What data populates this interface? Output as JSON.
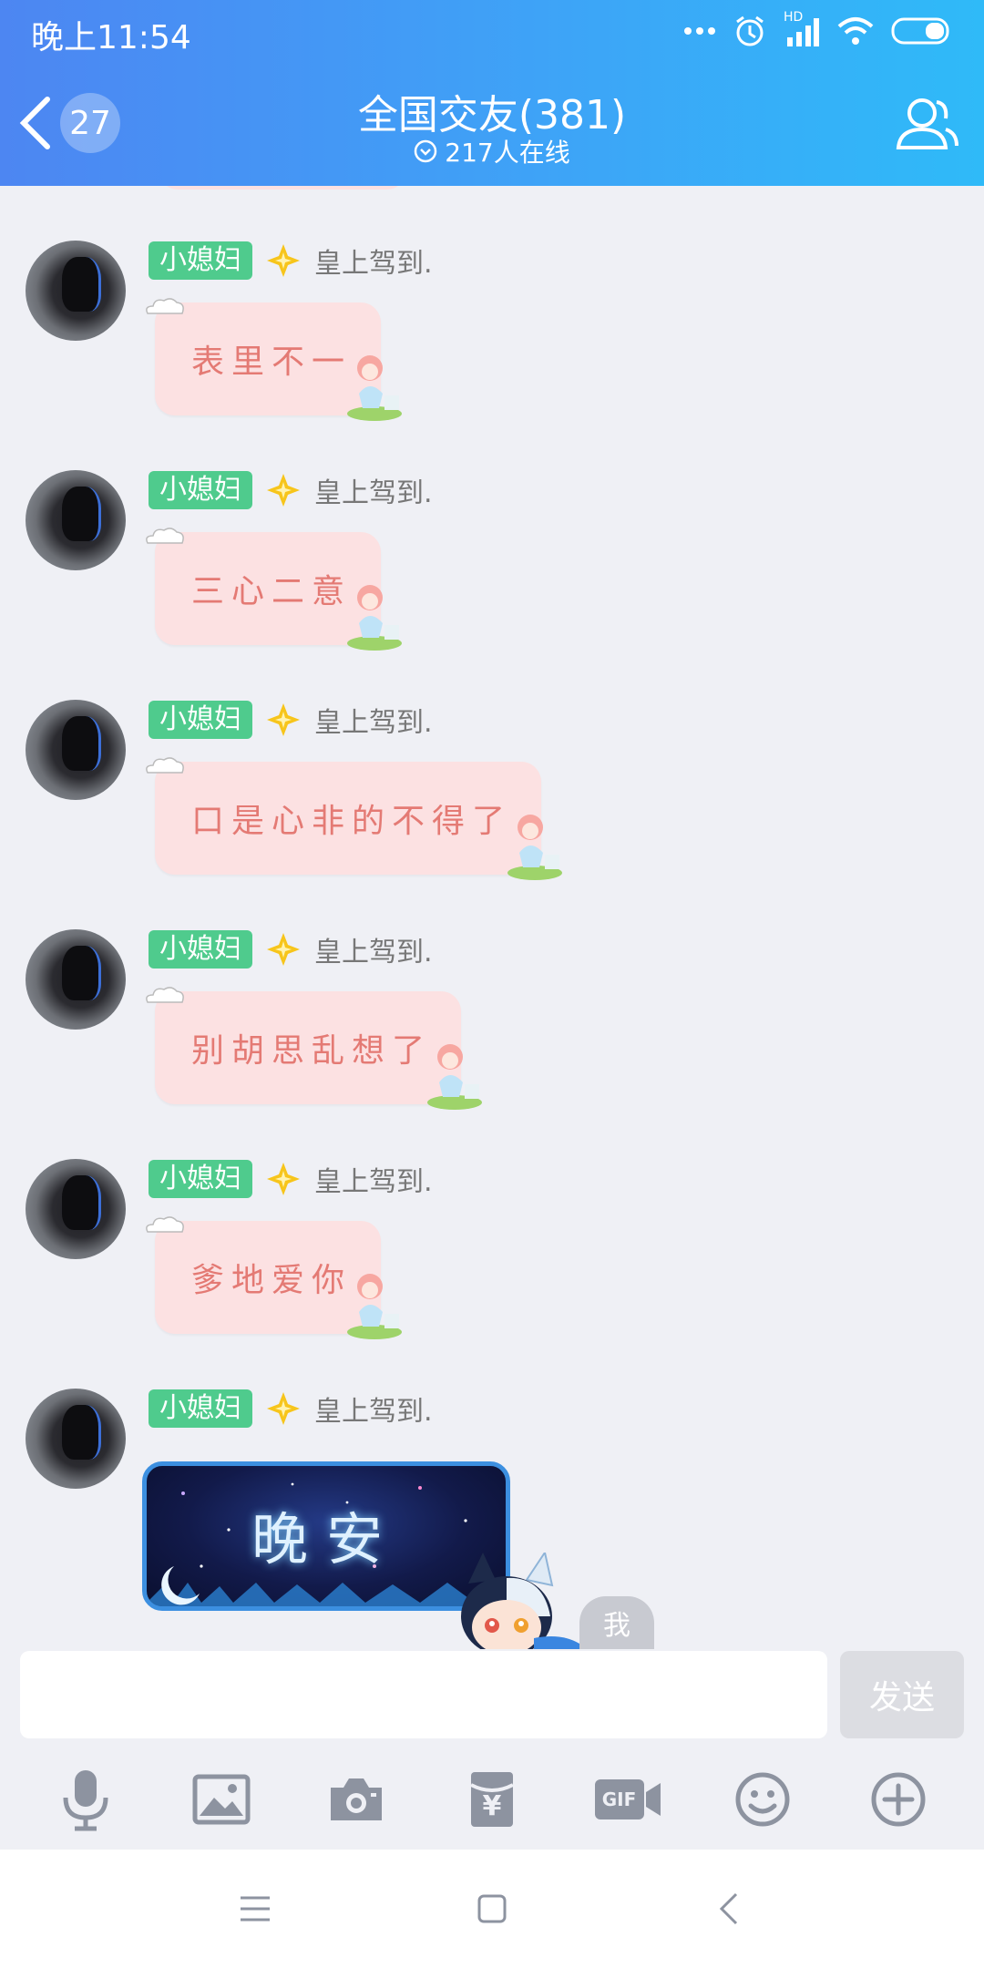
{
  "status_bar": {
    "time": "晚上11:54",
    "network_label": "HD"
  },
  "header": {
    "unread_count": "27",
    "group_name": "全国交友(381)",
    "online_text": "217人在线"
  },
  "messages": [
    {
      "sender": "小媳妇",
      "title": "皇上驾到.",
      "text": "表里不一"
    },
    {
      "sender": "小媳妇",
      "title": "皇上驾到.",
      "text": "三心二意"
    },
    {
      "sender": "小媳妇",
      "title": "皇上驾到.",
      "text": "口是心非的不得了"
    },
    {
      "sender": "小媳妇",
      "title": "皇上驾到.",
      "text": "别胡思乱想了"
    },
    {
      "sender": "小媳妇",
      "title": "皇上驾到.",
      "text": "爹地爱你"
    },
    {
      "sender": "小媳妇",
      "title": "皇上驾到.",
      "image_text": "晚安"
    }
  ],
  "self_label": "我",
  "input": {
    "value": "",
    "send_label": "发送"
  },
  "toolbar": {
    "icons": [
      "microphone-icon",
      "image-icon",
      "camera-icon",
      "red-packet-icon",
      "gif-icon",
      "emoji-icon",
      "plus-icon"
    ],
    "red_packet_symbol": "¥",
    "gif_label": "GIF"
  },
  "colors": {
    "header_start": "#4d86f2",
    "header_end": "#2fbaf8",
    "name_tag": "#4fcb8d",
    "bubble_bg": "#fce1e2",
    "bubble_text": "#e47a74"
  }
}
